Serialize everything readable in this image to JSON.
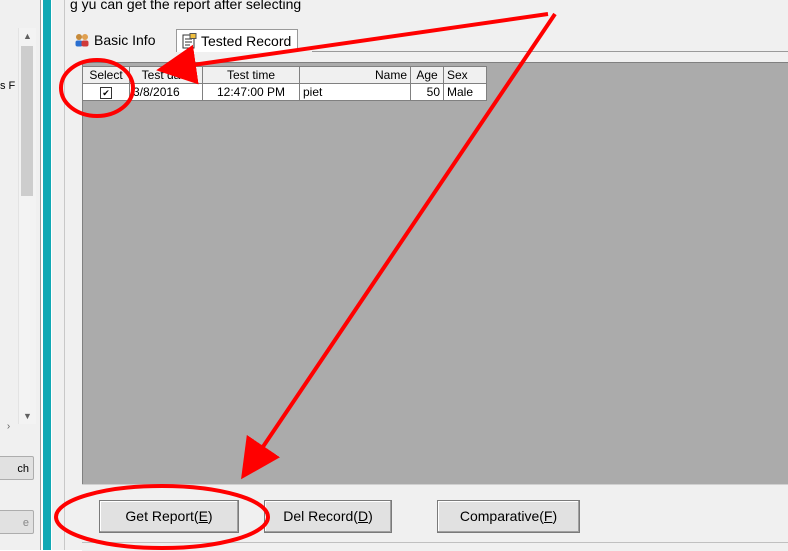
{
  "caption": "g yu can get the report after selecting",
  "left_pane": {
    "truncated_label": "s F",
    "search_button_label": "ch",
    "bottom_button_label": "e"
  },
  "tabs": [
    {
      "label": "Basic Info",
      "icon": "people-icon"
    },
    {
      "label": "Tested Record",
      "icon": "notepad-icon",
      "active": true
    }
  ],
  "records_table": {
    "headers": [
      "Select",
      "Test date",
      "Test time",
      "Name",
      "Age",
      "Sex"
    ],
    "rows": [
      {
        "select": "✔",
        "date": "3/8/2016",
        "time": "12:47:00 PM",
        "name": "piet",
        "age": "50",
        "sex": "Male"
      }
    ]
  },
  "buttons": {
    "get_report": {
      "text": "Get Report(",
      "key": "E",
      "close": ")"
    },
    "del_record": {
      "text": "Del Record(",
      "key": "D",
      "close": ")"
    },
    "comparative": {
      "text": "Comparative(",
      "key": "F",
      "close": ")"
    }
  },
  "colors": {
    "annotation": "#ff0000",
    "accent_bar": "#11a8b4",
    "grid_background": "#ababab"
  }
}
